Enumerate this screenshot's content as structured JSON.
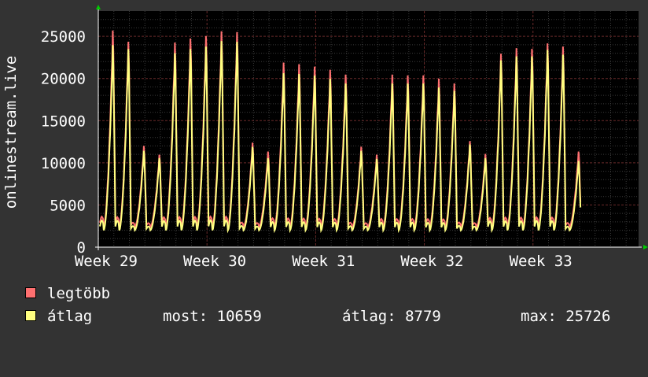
{
  "chart_data": {
    "type": "line",
    "ylabel": "onlinestream.live",
    "x_ticks": [
      "Week 29",
      "Week 30",
      "Week 31",
      "Week 32",
      "Week 33"
    ],
    "y_ticks": [
      "0",
      "5000",
      "10000",
      "15000",
      "20000",
      "25000"
    ],
    "ylim": [
      0,
      28000
    ],
    "grid": true,
    "series": [
      {
        "name": "legtöbb",
        "color": "#ff7070",
        "daily_peaks": [
          26900,
          25500,
          12500,
          11400,
          25400,
          25900,
          26200,
          26800,
          26700,
          12900,
          11800,
          22900,
          22700,
          22400,
          22000,
          21400,
          12400,
          11400,
          21400,
          21300,
          21300,
          20900,
          20300,
          13100,
          11500,
          24000,
          24700,
          24600,
          25300,
          24900,
          11800
        ]
      },
      {
        "name": "átlag",
        "color": "#ffff80",
        "daily_peaks": [
          25100,
          24600,
          11900,
          11000,
          24100,
          24600,
          24900,
          25600,
          25500,
          12400,
          11000,
          21600,
          21500,
          21300,
          20900,
          20300,
          11900,
          10900,
          20300,
          20300,
          20300,
          19800,
          19400,
          12700,
          11000,
          23200,
          23700,
          23700,
          24500,
          23900,
          10659
        ]
      }
    ]
  },
  "legend": {
    "max_label": "legtöbb",
    "avg_label": "átlag",
    "max_color": "#ff7070",
    "avg_color": "#ffff80"
  },
  "stats": {
    "current": "most: 10659",
    "average": "átlag: 8779",
    "maximum": "max: 25726"
  }
}
